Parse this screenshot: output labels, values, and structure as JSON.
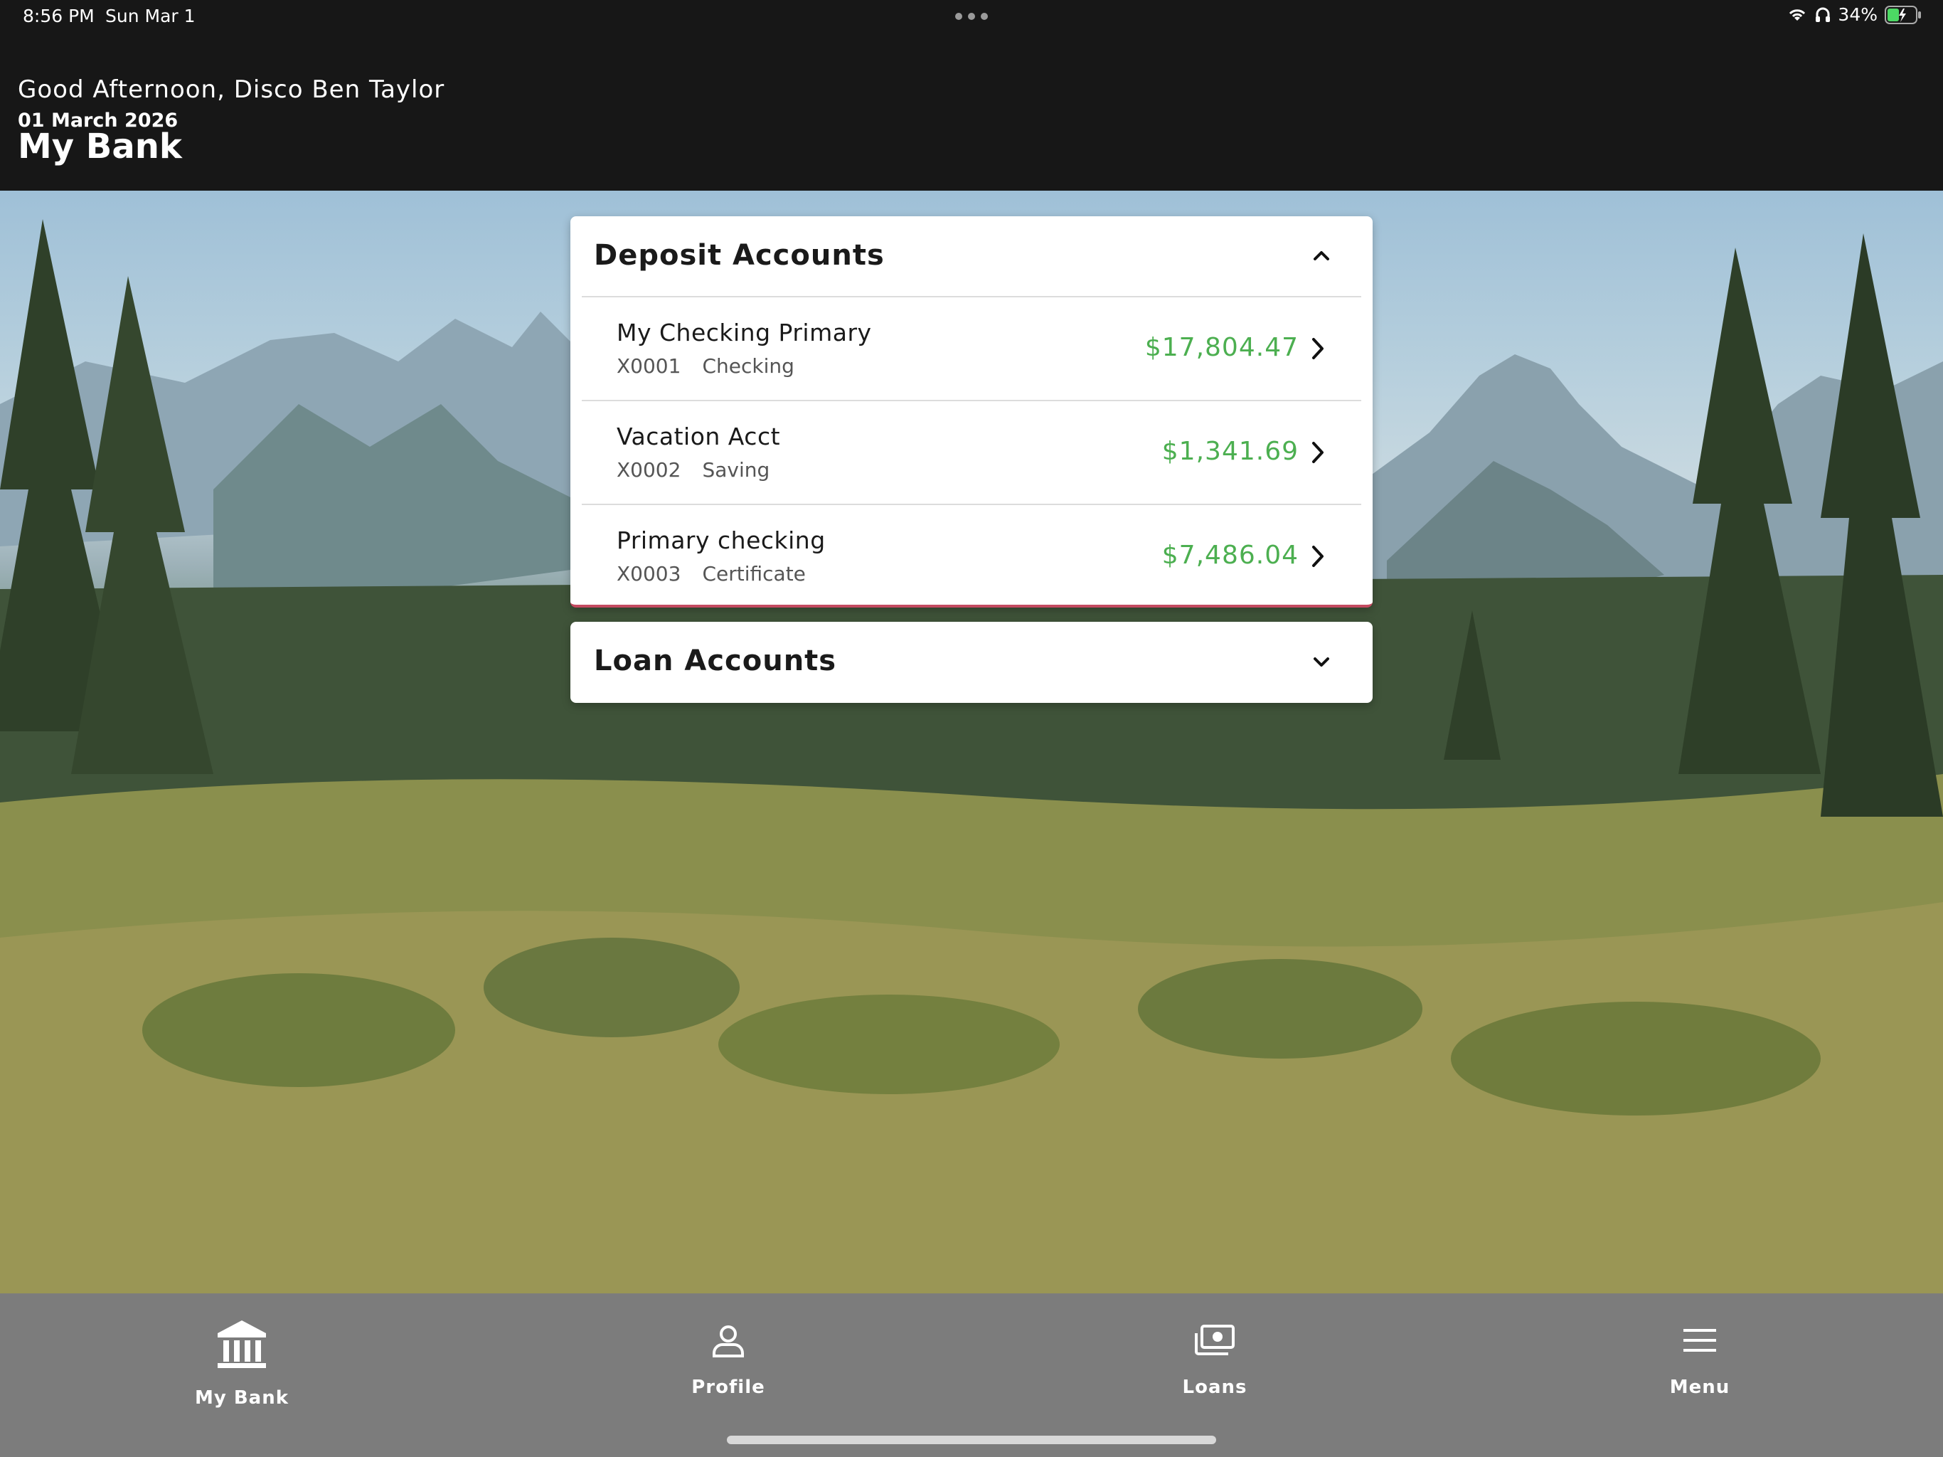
{
  "status_bar": {
    "time": "8:56 PM",
    "date": "Sun Mar 1",
    "battery": "34%",
    "icons": [
      "wifi-icon",
      "headphones-icon",
      "battery-charging-icon"
    ]
  },
  "header": {
    "greeting": "Good Afternoon, Disco Ben Taylor",
    "date": "01 March 2026",
    "title": "My Bank"
  },
  "deposit": {
    "title": "Deposit Accounts",
    "expanded": true,
    "accounts": [
      {
        "name": "My Checking Primary",
        "number": "X0001",
        "type": "Checking",
        "balance": "$17,804.47"
      },
      {
        "name": "Vacation Acct",
        "number": "X0002",
        "type": "Saving",
        "balance": "$1,341.69"
      },
      {
        "name": "Primary checking",
        "number": "X0003",
        "type": "Certificate",
        "balance": "$7,486.04"
      }
    ]
  },
  "loan": {
    "title": "Loan Accounts",
    "expanded": false
  },
  "nav": {
    "items": [
      {
        "label": "My Bank",
        "icon": "bank-icon"
      },
      {
        "label": "Profile",
        "icon": "person-icon"
      },
      {
        "label": "Loans",
        "icon": "cash-icon"
      },
      {
        "label": "Menu",
        "icon": "hamburger-icon"
      }
    ]
  },
  "colors": {
    "header_bg": "#171717",
    "balance_green": "#4caf50",
    "nav_bg": "#7c7c7c",
    "card_accent": "#c44a60"
  }
}
